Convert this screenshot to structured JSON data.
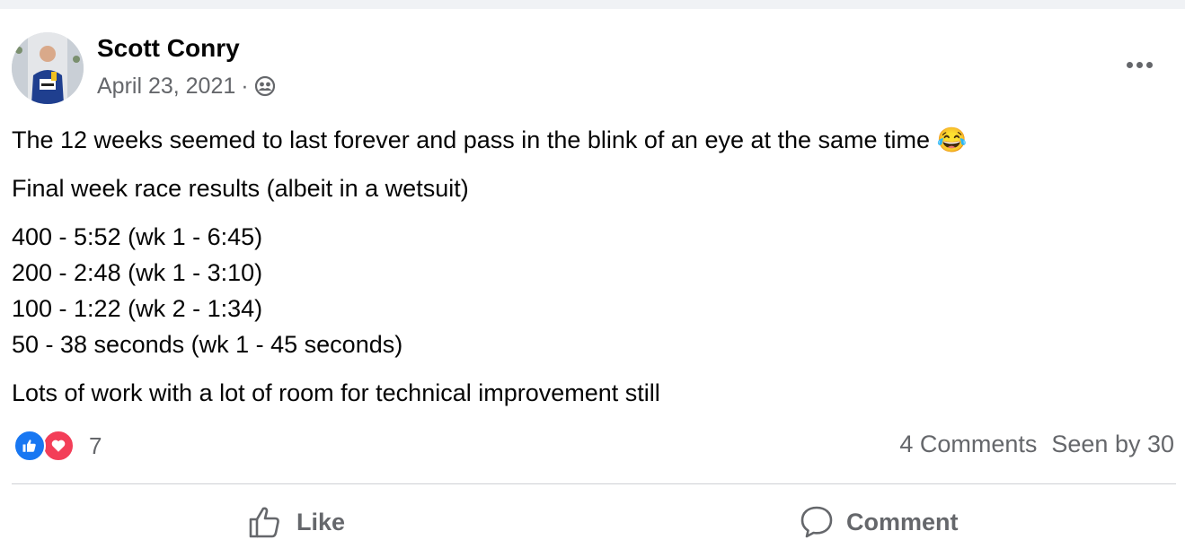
{
  "post": {
    "author": "Scott Conry",
    "date": "April 23, 2021",
    "separator": "·",
    "audience_icon": "friends-icon",
    "lines": [
      "The 12 weeks seemed to last forever and pass in the blink of an eye at the same time 😂",
      "Final week race results (albeit in a wetsuit)",
      "400 - 5:52 (wk 1 - 6:45)",
      "200 - 2:48 (wk 1 - 3:10)",
      "100 - 1:22 (wk 2 - 1:34)",
      "50 - 38 seconds (wk 1 - 45 seconds)",
      "Lots of work with a lot of room for technical improvement still"
    ]
  },
  "engagement": {
    "reaction_count": "7",
    "comments": "4 Comments",
    "seen_by": "Seen by 30"
  },
  "actions": {
    "like_label": "Like",
    "comment_label": "Comment"
  },
  "colors": {
    "like_blue": "#1877f2",
    "love_red": "#f33e58",
    "secondary_text": "#65676b"
  }
}
